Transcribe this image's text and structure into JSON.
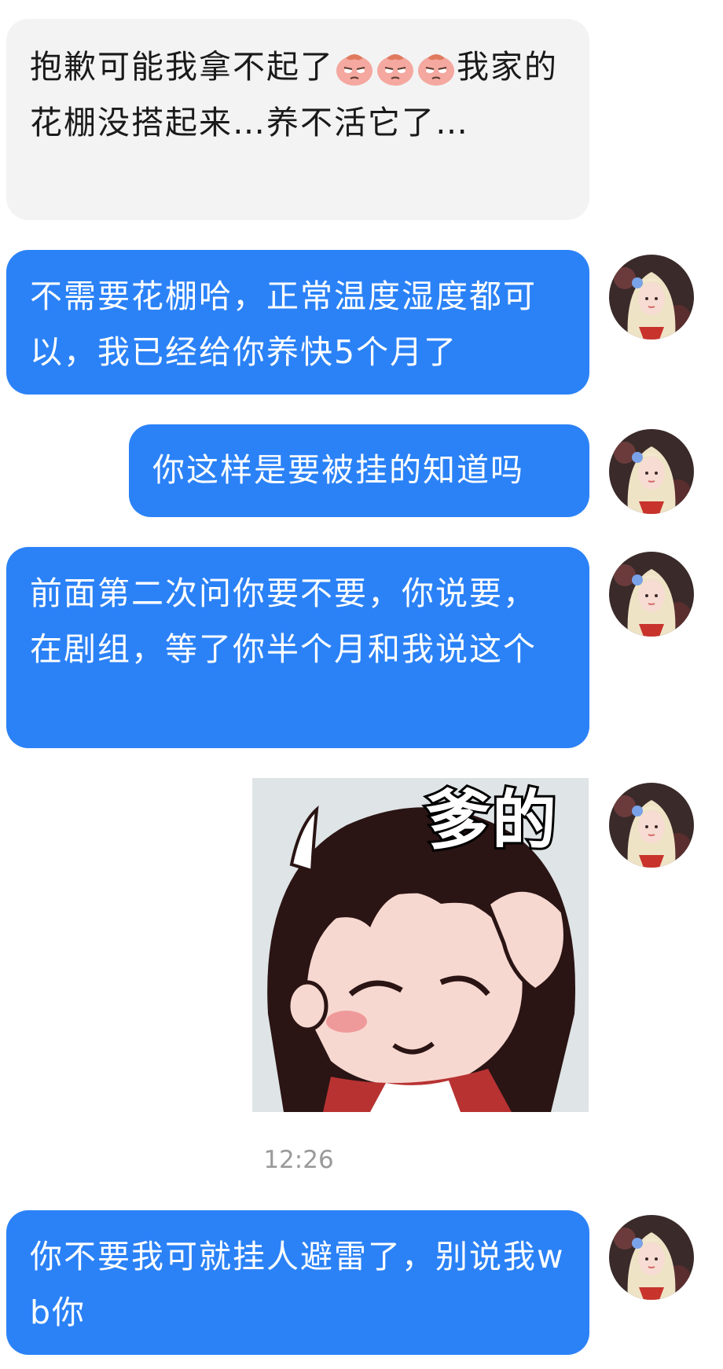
{
  "messages": [
    {
      "side": "incoming",
      "text": "抱歉可能我拿不起了🥺🥺🥺我家的花棚没搭起来…养不活它了…",
      "text_before_emoji": "抱歉可能我拿不起了",
      "text_after_emoji": "我家的花棚没搭起来…养不活它了…",
      "emoji_name": "crying-face-emoji"
    },
    {
      "side": "outgoing",
      "text": "不需要花棚哈，正常温度湿度都可以，我已经给你养快5个月了"
    },
    {
      "side": "outgoing",
      "text": "你这样是要被挂的知道吗"
    },
    {
      "side": "outgoing",
      "text": "前面第二次问你要不要，你说要，在剧组，等了你半个月和我说这个"
    },
    {
      "side": "outgoing",
      "type": "sticker",
      "caption": "爹的",
      "image": "cartoon-girl-sticker"
    },
    {
      "side": "outgoing",
      "text": "你不要我可就挂人避雷了，别说我wb你"
    }
  ],
  "timestamp": "12:26",
  "colors": {
    "outgoing_bubble": "#2b82f7",
    "incoming_bubble": "#f3f3f3",
    "timestamp": "#9a9a9a"
  }
}
